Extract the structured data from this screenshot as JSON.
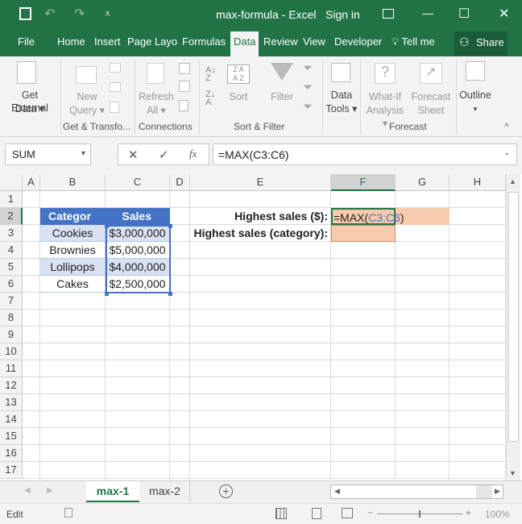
{
  "window": {
    "title": "max-formula - Excel",
    "sign_in": "Sign in",
    "minimize": "—",
    "maximize": "☐",
    "close": "✕",
    "undo": "↶",
    "redo": "↷",
    "qat": "⩡",
    "restore_ribbon": "⧉"
  },
  "tabs": [
    {
      "label": "File"
    },
    {
      "label": "Home"
    },
    {
      "label": "Insert"
    },
    {
      "label": "Page Layo"
    },
    {
      "label": "Formulas"
    },
    {
      "label": "Data"
    },
    {
      "label": "Review"
    },
    {
      "label": "View"
    },
    {
      "label": "Developer"
    },
    {
      "label": "Tell me"
    },
    {
      "label": "Share"
    }
  ],
  "ribbon": {
    "get_external_data": [
      "Get External",
      "Data ▾"
    ],
    "new_query": [
      "New",
      "Query ▾"
    ],
    "refresh_all": [
      "Refresh",
      "All ▾"
    ],
    "sort": "Sort",
    "filter": "Filter",
    "data_tools": [
      "Data",
      "Tools ▾"
    ],
    "what_if": [
      "What-If",
      "Analysis ▾"
    ],
    "forecast_sheet": [
      "Forecast",
      "Sheet"
    ],
    "outline": [
      "Outline",
      "▾"
    ],
    "groups": [
      "Get & Transfo...",
      "Connections",
      "Sort & Filter",
      "Forecast"
    ],
    "collapse": "^"
  },
  "formula_bar": {
    "name_box": "SUM",
    "cancel": "✕",
    "enter": "✓",
    "fx": "fx",
    "formula": "=MAX(C3:C6)"
  },
  "columns": [
    "A",
    "B",
    "C",
    "D",
    "E",
    "F",
    "G",
    "H"
  ],
  "rows": [
    "1",
    "2",
    "3",
    "4",
    "5",
    "6",
    "7",
    "8",
    "9",
    "10",
    "11",
    "12",
    "13",
    "14",
    "15",
    "16",
    "17"
  ],
  "table": {
    "headers": [
      "Categor",
      "Sales"
    ],
    "rows": [
      [
        "Cookies",
        "$3,000,000"
      ],
      [
        "Brownies",
        "$5,000,000"
      ],
      [
        "Lollipops",
        "$4,000,000"
      ],
      [
        "Cakes",
        "$2,500,000"
      ]
    ]
  },
  "labels": {
    "highest_sales": "Highest sales ($):",
    "highest_category": "Highest sales (category):"
  },
  "active_cell": {
    "prefix": "=MAX(",
    "ref": "C3:C6",
    "suffix": ")"
  },
  "sheets": [
    {
      "label": "max-1",
      "active": true
    },
    {
      "label": "max-2",
      "active": false
    }
  ],
  "status": {
    "mode": "Edit",
    "zoom": "100%",
    "zoom_minus": "−",
    "zoom_plus": "+"
  },
  "colors": {
    "brand": "#217346",
    "table_header": "#4472c4",
    "band": "#d9e1f2",
    "input_fill": "#f8cbad",
    "ref_blue": "#4472c4"
  }
}
